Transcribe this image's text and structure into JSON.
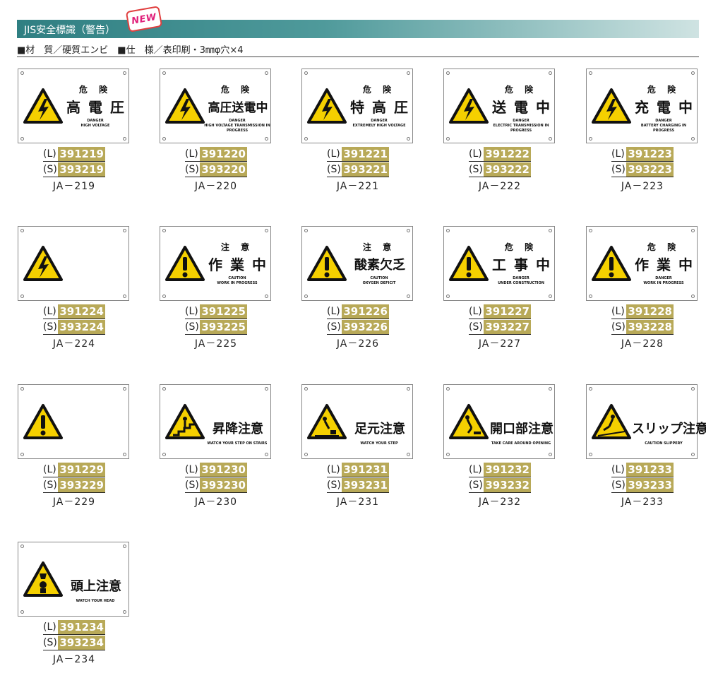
{
  "header": {
    "title": "JIS安全標識（警告）",
    "badge": "NEW"
  },
  "spec": "■材　質／硬質エンビ　■仕　様／表印刷・3㎜φ穴×4",
  "items": [
    {
      "small": "危 険",
      "big": "高 電 圧",
      "en": "DANGER\nHIGH VOLTAGE",
      "l": "391219",
      "s": "393219",
      "ja": "JA－219",
      "icon": "bolt"
    },
    {
      "small": "危 険",
      "big": "高圧送電中",
      "en": "DANGER\nHIGH VOLTAGE TRANSMISSION IN PROGRESS",
      "l": "391220",
      "s": "393220",
      "ja": "JA－220",
      "icon": "bolt"
    },
    {
      "small": "危 険",
      "big": "特 高 圧",
      "en": "DANGER\nEXTREMELY HIGH VOLTAGE",
      "l": "391221",
      "s": "393221",
      "ja": "JA－221",
      "icon": "bolt"
    },
    {
      "small": "危 険",
      "big": "送 電 中",
      "en": "DANGER\nELECTRIC TRANSMISSION IN PROGRESS",
      "l": "391222",
      "s": "393222",
      "ja": "JA－222",
      "icon": "bolt"
    },
    {
      "small": "危 険",
      "big": "充 電 中",
      "en": "DANGER\nBATTERY CHARGING IN PROGRESS",
      "l": "391223",
      "s": "393223",
      "ja": "JA－223",
      "icon": "bolt"
    },
    {
      "small": "",
      "big": "",
      "en": "",
      "l": "391224",
      "s": "393224",
      "ja": "JA－224",
      "icon": "bolt"
    },
    {
      "small": "注 意",
      "big": "作 業 中",
      "en": "CAUTION\nWORK IN PROGRESS",
      "l": "391225",
      "s": "393225",
      "ja": "JA－225",
      "icon": "excl"
    },
    {
      "small": "注 意",
      "big": "酸素欠乏",
      "en": "CAUTION\nOXYGEN DEFICIT",
      "l": "391226",
      "s": "393226",
      "ja": "JA－226",
      "icon": "excl"
    },
    {
      "small": "危 険",
      "big": "工 事 中",
      "en": "DANGER\nUNDER CONSTRUCTION",
      "l": "391227",
      "s": "393227",
      "ja": "JA－227",
      "icon": "excl"
    },
    {
      "small": "危 険",
      "big": "作 業 中",
      "en": "DANGER\nWORK IN PROGRESS",
      "l": "391228",
      "s": "393228",
      "ja": "JA－228",
      "icon": "excl"
    },
    {
      "small": "",
      "big": "",
      "en": "",
      "l": "391229",
      "s": "393229",
      "ja": "JA－229",
      "icon": "excl"
    },
    {
      "small": "",
      "big": "昇降注意",
      "en": "WATCH YOUR STEP ON STAIRS",
      "l": "391230",
      "s": "393230",
      "ja": "JA－230",
      "icon": "stairs"
    },
    {
      "small": "",
      "big": "足元注意",
      "en": "WATCH YOUR STEP",
      "l": "391231",
      "s": "393231",
      "ja": "JA－231",
      "icon": "trip"
    },
    {
      "small": "",
      "big": "開口部注意",
      "en": "TAKE CARE AROUND OPENING",
      "l": "391232",
      "s": "393232",
      "ja": "JA－232",
      "icon": "fall"
    },
    {
      "small": "",
      "big": "スリップ注意",
      "en": "CAUTION  SLIPPERY",
      "l": "391233",
      "s": "393233",
      "ja": "JA－233",
      "icon": "slip"
    },
    {
      "small": "",
      "big": "頭上注意",
      "en": "WATCH YOUR HEAD",
      "l": "391234",
      "s": "393234",
      "ja": "JA－234",
      "icon": "head"
    }
  ],
  "labels": {
    "l": "(L)",
    "s": "(S)"
  },
  "colors": {
    "warning_yellow": "#f5d000",
    "code_badge": "#b8a958",
    "header_teal": "#2f7f82"
  }
}
